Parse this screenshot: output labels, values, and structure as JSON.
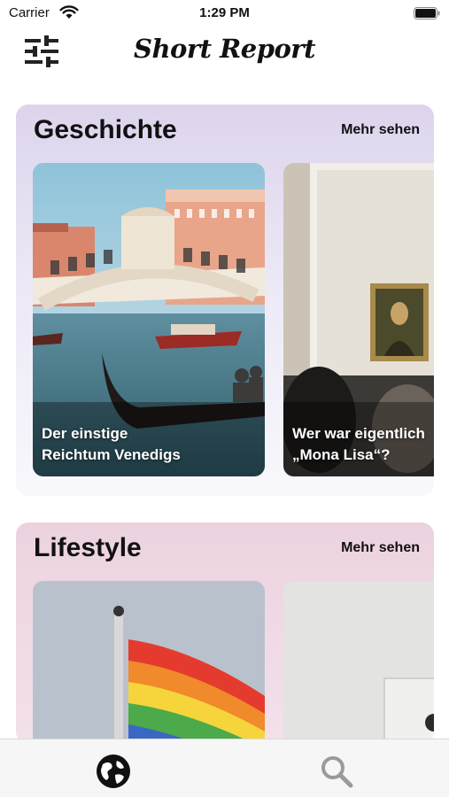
{
  "status_bar": {
    "carrier": "Carrier",
    "time": "1:29 PM",
    "wifi_icon": "wifi-icon",
    "battery_icon": "battery-icon"
  },
  "nav": {
    "title": "Short Report",
    "filter_icon": "sliders-icon"
  },
  "sections": [
    {
      "title": "Geschichte",
      "more_label": "Mehr sehen",
      "accent_color": "#ddd4ec",
      "cards": [
        {
          "caption": "Der einstige\nReichtum Venedigs"
        },
        {
          "caption": "Wer war eigentlich\n„Mona Lisa“?"
        }
      ]
    },
    {
      "title": "Lifestyle",
      "more_label": "Mehr sehen",
      "accent_color": "#ecd2df",
      "cards": []
    }
  ],
  "tab_bar": {
    "tabs": [
      {
        "icon": "globe-icon",
        "selected": true
      },
      {
        "icon": "search-icon",
        "selected": false
      }
    ]
  }
}
